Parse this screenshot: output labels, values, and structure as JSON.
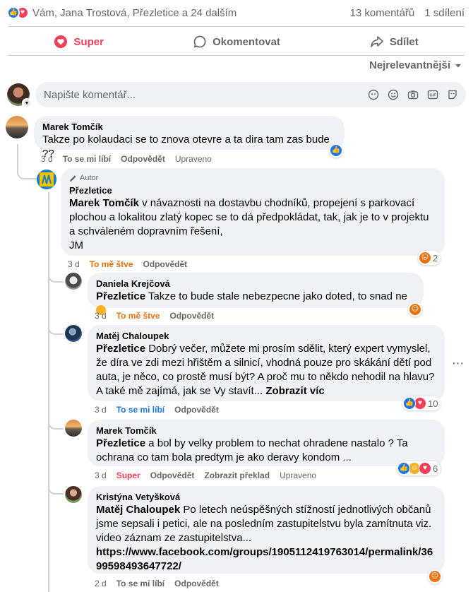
{
  "summary": {
    "names": "Vám, Jana Trostová, Přezletice a 24 dalším",
    "comments": "13 komentářů",
    "shares": "1 sdílení"
  },
  "actions": {
    "super": "Super",
    "comment": "Okomentovat",
    "share": "Sdílet"
  },
  "sort": {
    "label": "Nejrelevantnější"
  },
  "composer": {
    "placeholder": "Napište komentář..."
  },
  "comments": [
    {
      "name": "Marek Tomčík",
      "text": "Takze po kolaudaci se to znova otevre a ta dira tam zas bude ??",
      "time": "3 d",
      "like": "To se mi líbí",
      "reply": "Odpovědět",
      "edited": "Upraveno"
    },
    {
      "author_tag": "Autor",
      "name": "Přezletice",
      "mention": "Marek Tomčík",
      "text": " v návaznosti na dostavbu chodníků, propejení s parkovací plochou a lokalitou zlatý kopec se to dá předpokládat, tak, jak je to v projektu a schváleném dopravním řešení,",
      "signature": "JM",
      "time": "3 d",
      "like": "To mě štve",
      "reply": "Odpovědět",
      "reaction_count": "2"
    },
    {
      "name": "Daniela Krejčová",
      "mention": "Přezletice",
      "text": " Takze to bude stale nebezpecne jako doted, to snad ne",
      "time": "3 d",
      "like": "To mě štve",
      "reply": "Odpovědět"
    },
    {
      "name": "Matěj Chaloupek",
      "mention": "Přezletice",
      "text": " Dobrý večer, můžete mi prosím sdělit, který expert vymyslel, že díra ve zdi mezi hřištěm a silnicí, vhodná pouze pro skákání dětí pod auta, je něco, co prostě musí být? A proč mu to někdo nehodil na hlavu? A také mě zajímá, jak se Vy stavít...",
      "more": "Zobrazit víc",
      "time": "3 d",
      "like": "To se mi líbí",
      "reply": "Odpovědět",
      "reaction_count": "10"
    },
    {
      "name": "Marek Tomčík",
      "mention": "Přezletice",
      "text": " a bol by velky problem to nechat ohradene nastalo ? Ta ochrana co tam bola predtym je ako deravy kondom ...",
      "time": "3 d",
      "like": "Super",
      "reply": "Odpovědět",
      "translate": "Zobrazit překlad",
      "edited": "Upraveno",
      "reaction_count": "6"
    },
    {
      "name": "Kristýna Vetyšková",
      "mention": "Matěj Chaloupek",
      "text": " Po letech neúspěšných stížností jednotlivých občanů jsme sepsali i petici, ale na posledním zastupitelstvu byla zamítnuta viz. video záznam ze zastupitelstva...",
      "link": "https://www.facebook.com/groups/1905112419763014/permalink/3699598493647722/",
      "time": "2 d",
      "like": "To se mi líbí",
      "reply": "Odpovědět"
    }
  ],
  "colors": {
    "accent": "#1877f2",
    "love": "#f33e58",
    "angry": "#e9710f",
    "bubble": "#f0f2f5",
    "muted": "#65676b"
  }
}
